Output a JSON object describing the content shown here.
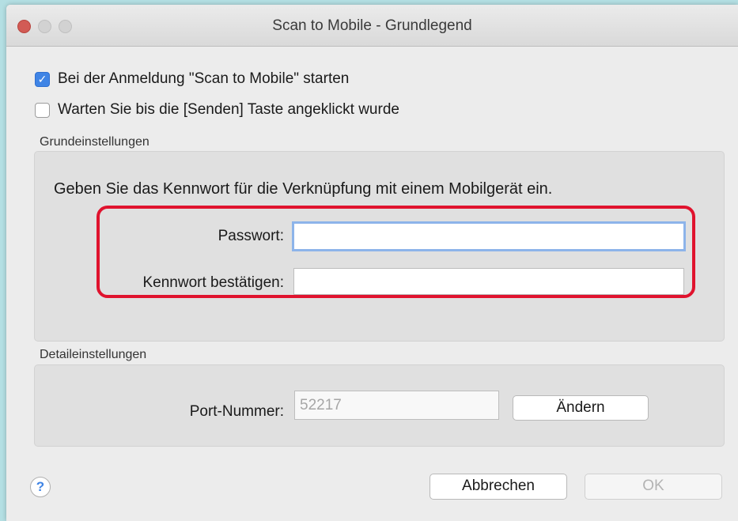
{
  "window": {
    "title": "Scan to Mobile - Grundlegend"
  },
  "options": {
    "startup_label": "Bei der Anmeldung \"Scan to Mobile\" starten",
    "startup_checked": true,
    "wait_label": "Warten Sie bis die [Senden] Taste angeklickt wurde",
    "wait_checked": false
  },
  "basic": {
    "section_label": "Grundeinstellungen",
    "instructions": "Geben Sie das Kennwort für die Verknüpfung mit einem Mobilgerät ein.",
    "password_label": "Passwort:",
    "password_value": "",
    "confirm_label": "Kennwort bestätigen:",
    "confirm_value": ""
  },
  "detail": {
    "section_label": "Detaileinstellungen",
    "port_label": "Port-Nummer:",
    "port_value": "52217",
    "change_button": "Ändern"
  },
  "footer": {
    "help_glyph": "?",
    "cancel_button": "Abbrechen",
    "ok_button": "OK"
  },
  "colors": {
    "highlight_border": "#e0132e",
    "checkbox_accent": "#3f84e5",
    "background": "#b4dfe3"
  }
}
